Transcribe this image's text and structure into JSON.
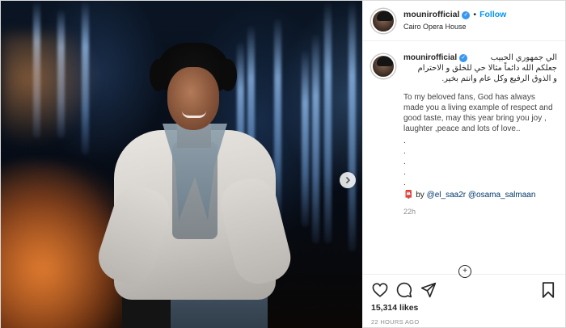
{
  "post": {
    "username": "mounirofficial",
    "follow_label": "Follow",
    "location": "Cairo Opera House",
    "caption_arabic_1": "الي جمهوري الحبيب",
    "caption_arabic_2": "جعلكم الله دائماً مثالا حي للخلق و الاحترام",
    "caption_arabic_3": "و الذوق الرفيع وكل عام وانتم بخير.",
    "caption_english": "To my beloved fans, God has always made you a living example of respect and good taste, may this year bring you joy , laughter ,peace and lots of love..",
    "caption_dots": [
      ".",
      ".",
      ".",
      ".",
      "."
    ],
    "credit_prefix": "📮 by",
    "mention_1": "@el_saa2r",
    "mention_2": "@osama_salmaan",
    "time_ago": "22h",
    "likes": "15,314 likes",
    "date": "22 HOURS AGO"
  },
  "icons": {
    "verified": "verified-badge-icon",
    "like": "heart-icon",
    "comment": "comment-icon",
    "share": "share-icon",
    "save": "bookmark-icon",
    "next": "chevron-right-icon",
    "load_more": "plus-circle-icon"
  },
  "colors": {
    "link_blue": "#0095f6",
    "verified_blue": "#3897f0",
    "mention_navy": "#00376b",
    "muted_gray": "#8e8e8e"
  }
}
